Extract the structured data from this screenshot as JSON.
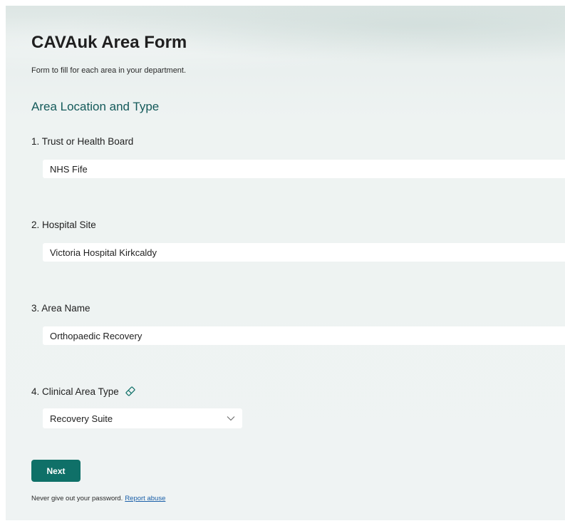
{
  "form": {
    "title": "CAVAuk Area Form",
    "subtitle": "Form to fill for each area in your department."
  },
  "section": {
    "title": "Area Location and Type"
  },
  "questions": [
    {
      "label": "1. Trust or Health Board",
      "value": "NHS Fife"
    },
    {
      "label": "2. Hospital Site",
      "value": "Victoria Hospital Kirkcaldy"
    },
    {
      "label": "3. Area Name",
      "value": "Orthopaedic Recovery"
    },
    {
      "label": "4. Clinical Area Type",
      "value": "Recovery Suite",
      "icon": "eraser-icon",
      "control": "dropdown"
    }
  ],
  "actions": {
    "next_label": "Next"
  },
  "footer": {
    "text": "Never give out your password.",
    "link": "Report abuse"
  },
  "colors": {
    "accent": "#0f7068",
    "section_title": "#145a5a",
    "link": "#1a5fa8"
  }
}
